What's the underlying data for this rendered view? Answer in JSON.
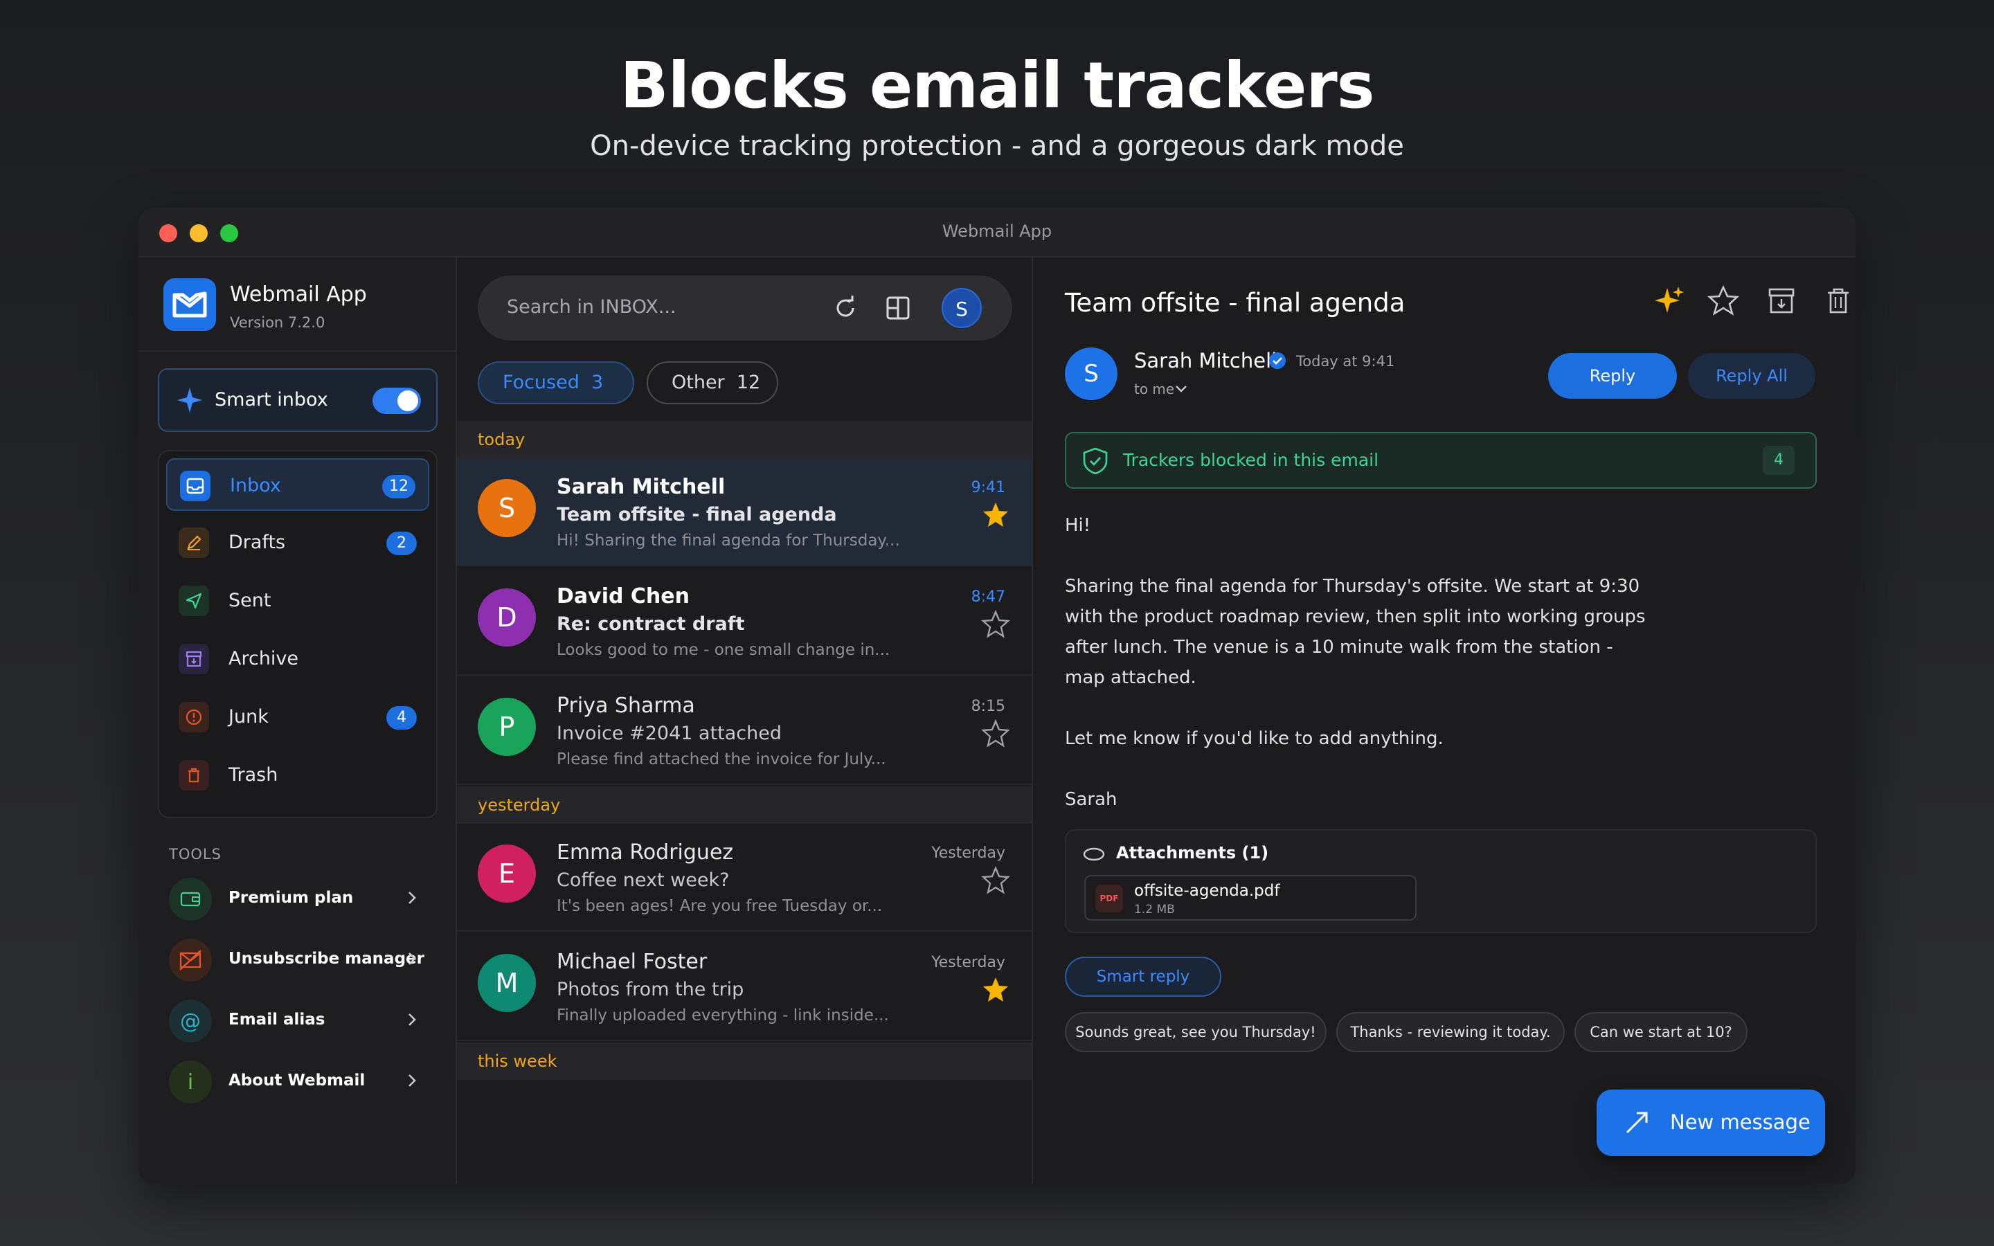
{
  "hero": {
    "title": "Blocks email trackers",
    "subtitle": "On-device tracking protection - and a gorgeous dark mode"
  },
  "window": {
    "title": "Webmail App"
  },
  "sidebar": {
    "app_name": "Webmail App",
    "version": "Version 7.2.0",
    "smart_inbox": {
      "label": "Smart inbox",
      "enabled": true
    },
    "folders": [
      {
        "label": "Inbox",
        "badge": "12",
        "icon": "inbox-icon",
        "active": true
      },
      {
        "label": "Drafts",
        "badge": "2",
        "icon": "pencil-icon"
      },
      {
        "label": "Sent",
        "badge": "",
        "icon": "send-icon"
      },
      {
        "label": "Archive",
        "badge": "",
        "icon": "archive-icon"
      },
      {
        "label": "Junk",
        "badge": "4",
        "icon": "warning-icon"
      },
      {
        "label": "Trash",
        "badge": "",
        "icon": "trash-icon"
      }
    ],
    "tools_title": "TOOLS",
    "tools": [
      {
        "label": "Premium plan",
        "icon": "wallet-icon"
      },
      {
        "label": "Unsubscribe manager",
        "icon": "unsubscribe-icon"
      },
      {
        "label": "Email alias",
        "icon": "at-icon"
      },
      {
        "label": "About Webmail",
        "icon": "info-icon"
      }
    ]
  },
  "list": {
    "search_placeholder": "Search in INBOX...",
    "avatar_initial": "S",
    "tabs": [
      {
        "label": "Focused",
        "count": "3"
      },
      {
        "label": "Other",
        "count": "12"
      }
    ],
    "sections": [
      "today",
      "yesterday",
      "this week"
    ],
    "messages": [
      {
        "initial": "S",
        "color": "#e8720f",
        "from": "Sarah Mitchell",
        "subject": "Team offsite - final agenda",
        "preview": "Hi! Sharing the final agenda for Thursday...",
        "time": "9:41",
        "starred": true,
        "unread": true
      },
      {
        "initial": "D",
        "color": "#8e2fb0",
        "from": "David Chen",
        "subject": "Re: contract draft",
        "preview": "Looks good to me - one small change in...",
        "time": "8:47",
        "starred": false,
        "unread": true
      },
      {
        "initial": "P",
        "color": "#1aa35a",
        "from": "Priya Sharma",
        "subject": "Invoice #2041 attached",
        "preview": "Please find attached the invoice for July...",
        "time": "8:15",
        "starred": false,
        "unread": false
      },
      {
        "initial": "E",
        "color": "#d0215e",
        "from": "Emma Rodriguez",
        "subject": "Coffee next week?",
        "preview": "It's been ages! Are you free Tuesday or...",
        "time": "Yesterday",
        "starred": false,
        "unread": false
      },
      {
        "initial": "M",
        "color": "#0f8a72",
        "from": "Michael Foster",
        "subject": "Photos from the trip",
        "preview": "Finally uploaded everything - link inside...",
        "time": "Yesterday",
        "starred": true,
        "unread": false
      }
    ]
  },
  "reader": {
    "subject": "Team offsite - final agenda",
    "sender_initial": "S",
    "sender": "Sarah Mitchell",
    "date": "Today at 9:41",
    "to": "to me",
    "reply": "Reply",
    "reply_all": "Reply All",
    "tracker_label": "Trackers blocked in this email",
    "tracker_count": "4",
    "body": [
      "Hi!",
      "Sharing the final agenda for Thursday's offsite. We start at 9:30",
      "with the product roadmap review, then split into working groups",
      "after lunch. The venue is a 10 minute walk from the station -",
      "map attached.",
      "Let me know if you'd like to add anything.",
      "Sarah"
    ],
    "attachments_title": "Attachments (1)",
    "attachment": {
      "type": "PDF",
      "name": "offsite-agenda.pdf",
      "size": "1.2 MB"
    },
    "smart_reply": "Smart reply",
    "suggestions": [
      "Sounds great, see you Thursday!",
      "Thanks - reviewing it today.",
      "Can we start at 10?"
    ]
  },
  "fab": {
    "label": "New message"
  },
  "colors": {
    "accent": "#1d72e8",
    "tracker": "#3ed598",
    "section": "#f0a818",
    "star": "#f7b500"
  }
}
